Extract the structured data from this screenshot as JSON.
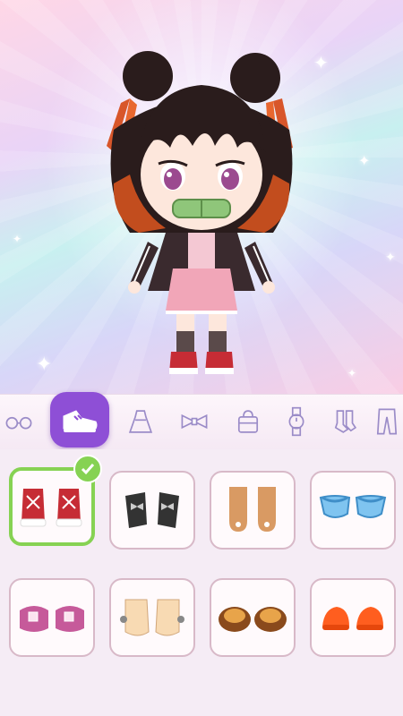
{
  "tabs": [
    {
      "id": "glasses",
      "icon": "glasses-icon"
    },
    {
      "id": "shoes",
      "icon": "sneaker-icon",
      "active": true
    },
    {
      "id": "dress",
      "icon": "dress-icon"
    },
    {
      "id": "bow",
      "icon": "bow-icon"
    },
    {
      "id": "bag",
      "icon": "handbag-icon"
    },
    {
      "id": "watch",
      "icon": "watch-icon"
    },
    {
      "id": "socks",
      "icon": "socks-icon"
    },
    {
      "id": "pants",
      "icon": "pants-icon"
    }
  ],
  "items": [
    {
      "id": "red-sneakers",
      "icon": "red-sneakers-icon",
      "selected": true
    },
    {
      "id": "black-bow-shoes",
      "icon": "black-bow-shoes-icon"
    },
    {
      "id": "brown-boots",
      "icon": "brown-boots-icon"
    },
    {
      "id": "blue-flats",
      "icon": "blue-flats-icon"
    },
    {
      "id": "pink-buckle-shoes",
      "icon": "pink-buckle-shoes-icon"
    },
    {
      "id": "cream-booties",
      "icon": "cream-booties-icon"
    },
    {
      "id": "brown-sandals",
      "icon": "brown-sandals-icon"
    },
    {
      "id": "orange-slippers",
      "icon": "orange-slippers-icon"
    }
  ],
  "colors": {
    "accent": "#8e4fd6",
    "selected_border": "#86d253",
    "item_border": "#d8b9c8"
  }
}
